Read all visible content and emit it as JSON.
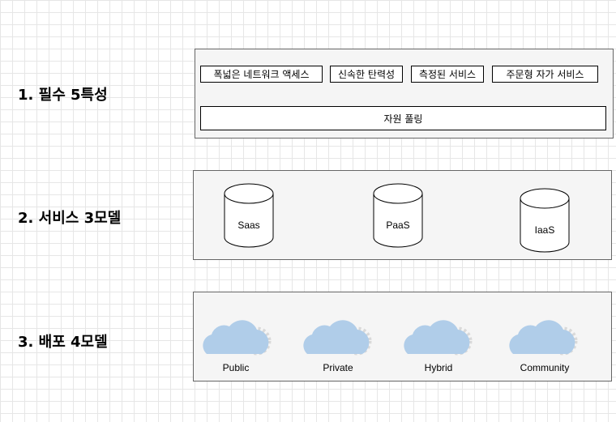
{
  "rows": [
    {
      "label": "1. 필수 5특성"
    },
    {
      "label": "2. 서비스 3모델"
    },
    {
      "label": "3. 배포 4모델"
    }
  ],
  "characteristics": [
    "폭넓은 네트워크 액세스",
    "신속한 탄력성",
    "측정된 서비스",
    "주문형 자가 서비스",
    "자원 풀링"
  ],
  "service_models": [
    "Saas",
    "PaaS",
    "IaaS"
  ],
  "deployment_models": [
    "Public",
    "Private",
    "Hybrid",
    "Community"
  ],
  "colors": {
    "cloud": "#b0cde9",
    "gear": "#d9d9d9",
    "panel": "#f5f5f5"
  }
}
